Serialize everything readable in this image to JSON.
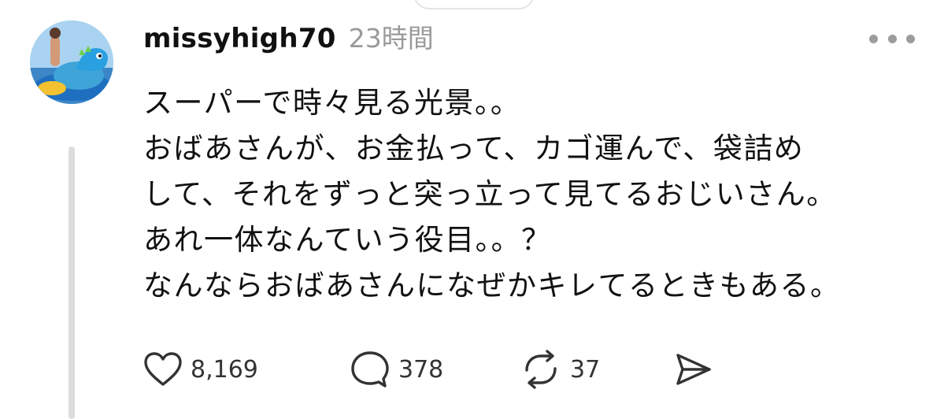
{
  "post": {
    "username": "missyhigh70",
    "timestamp": "23時間",
    "lines": [
      "スーパーで時々見る光景。。",
      "おばあさんが、お金払って、カゴ運んで、袋詰め",
      "して、それをずっと突っ立って見てるおじいさん。",
      "あれ一体なんていう役目。。？",
      "なんならおばあさんになぜかキレてるときもある。"
    ]
  },
  "actions": {
    "like_count": "8,169",
    "reply_count": "378",
    "repost_count": "37"
  },
  "icons": {
    "more": "more-dots-icon",
    "like": "heart-icon",
    "reply": "speech-bubble-icon",
    "repost": "repost-arrows-icon",
    "share": "paper-plane-icon"
  },
  "colors": {
    "text": "#111111",
    "muted": "#9a9a9a",
    "icon": "#333333",
    "thread_line": "#dddddd"
  }
}
